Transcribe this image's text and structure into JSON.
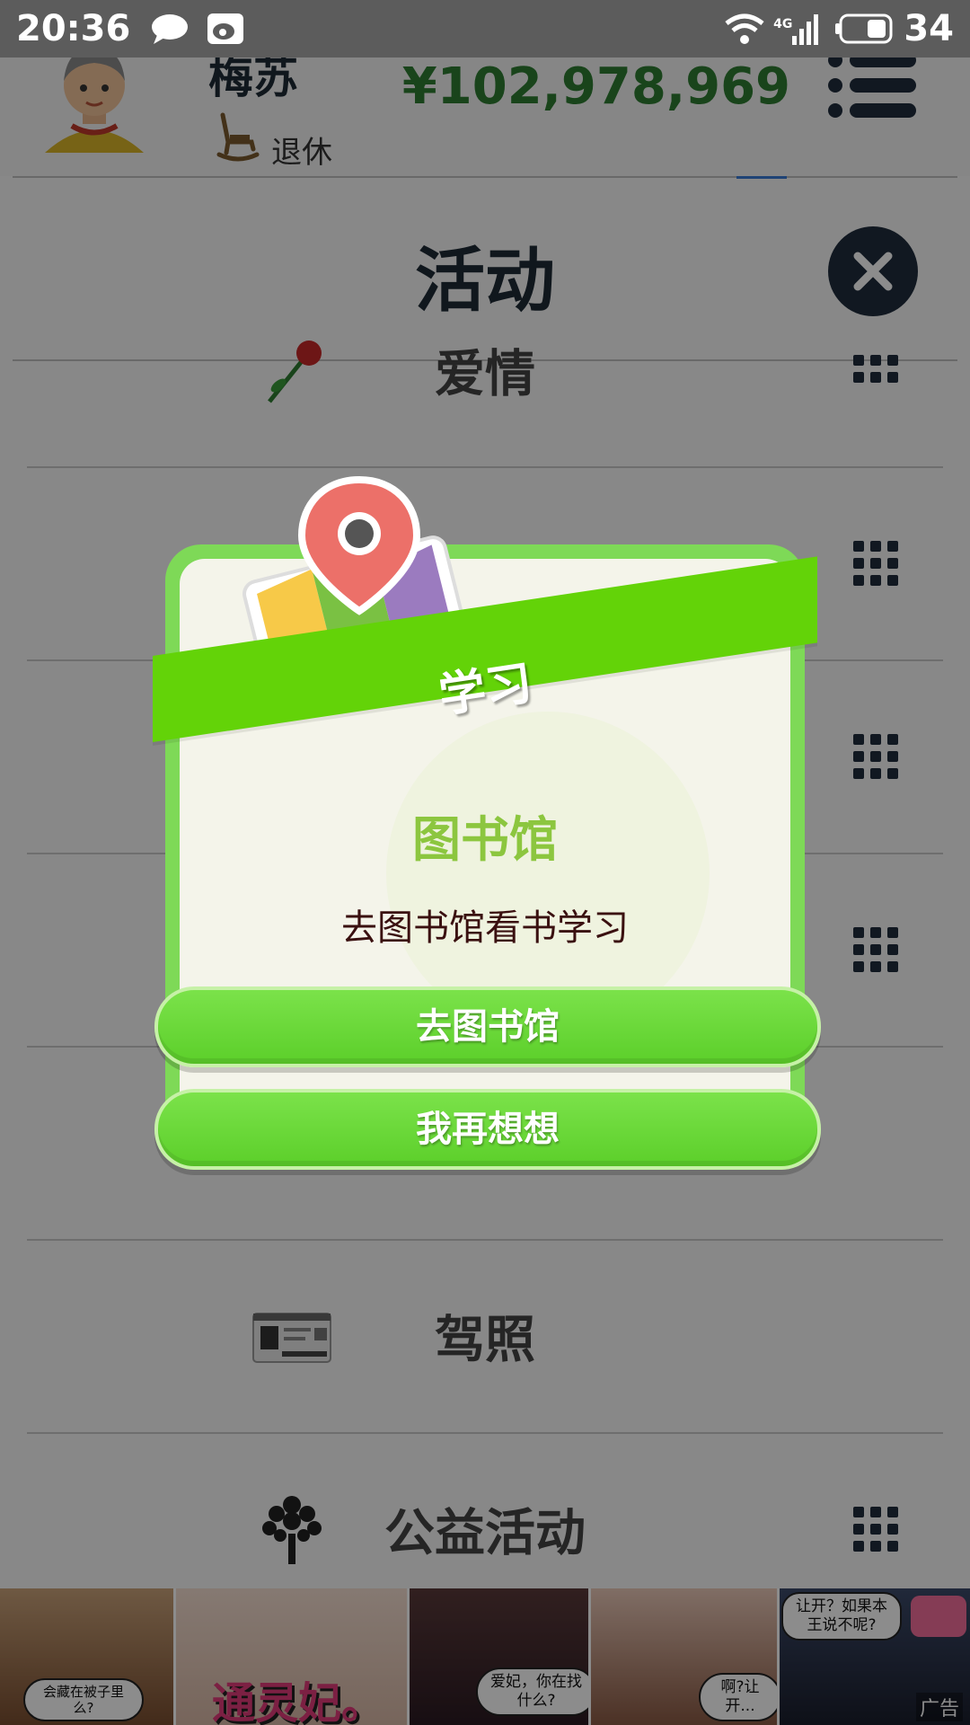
{
  "status_bar": {
    "time": "20:36",
    "network": "4G",
    "battery": "34"
  },
  "header": {
    "name": "梅苏",
    "status": "退休",
    "money": "¥102,978,969"
  },
  "section": {
    "title": "活动"
  },
  "list": [
    {
      "label": "爱情",
      "icon": "rose-icon"
    },
    {
      "label": "",
      "icon": "item-icon"
    },
    {
      "label": "",
      "icon": "item-icon"
    },
    {
      "label": "",
      "icon": "item-icon"
    },
    {
      "label": "",
      "icon": "item-icon"
    },
    {
      "label": "驾照",
      "icon": "drivers-license-icon"
    },
    {
      "label": "公益活动",
      "icon": "tree-icon"
    }
  ],
  "dialog": {
    "ribbon": "学习",
    "title": "图书馆",
    "description": "去图书馆看书学习",
    "confirm": "去图书馆",
    "cancel": "我再想想"
  },
  "ad": {
    "label": "广告",
    "bubbles": [
      "会藏在被子里么?",
      "爱妃，你在找什么?",
      "啊?让开...",
      "让开？如果本王说不呢?"
    ],
    "logo": "通灵妃。"
  },
  "colors": {
    "accent_green": "#63d308",
    "money_green": "#2e7d32",
    "title_green": "#8cc63f",
    "dark_navy": "#1f2d3d"
  }
}
